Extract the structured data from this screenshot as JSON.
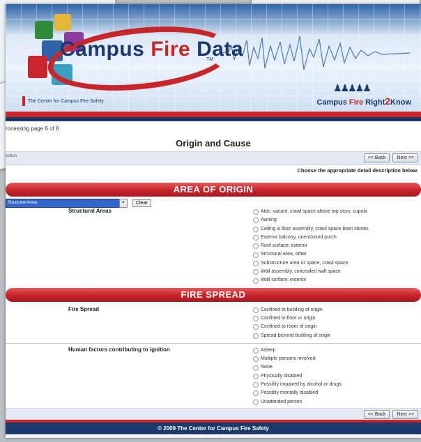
{
  "banner": {
    "logo_word1": "Campus",
    "logo_word2": "Fire",
    "logo_word3": "Data",
    "tm": "TM",
    "center_tag": "The Center for Campus Fire Safety",
    "slogan_1": "Campus",
    "slogan_2": "Fire",
    "slogan_3": "Right",
    "slogan_4": "2",
    "slogan_5": "Know"
  },
  "status": "rocessing page 6 of 8",
  "page_title": "Origin and Cause",
  "nav": {
    "left_label": "ection",
    "back_label": "<< Back",
    "next_label": "Next >>",
    "instruction": "Choose the appropriate detail description below."
  },
  "area_of_origin": {
    "header": "AREA OF ORIGIN",
    "select_value": "Structural Areas",
    "clear_label": "Clear",
    "question": "Structural Areas",
    "options": [
      "Attic: vacant, crawl space above top story, cupola",
      "Awning",
      "Ceiling & floor assembly, crawl space btwn stories",
      "Exterior balcony, unenclosed porch",
      "Roof surface: exterior",
      "Structural area, other",
      "Substructure area or space, crawl space",
      "Wall assembly, concealed wall space",
      "Wall surface: exterior"
    ]
  },
  "fire_spread": {
    "header": "FIRE SPREAD",
    "question": "Fire Spread",
    "options": [
      "Confined to building of origin",
      "Confined to floor or origin",
      "Confined to room of origin",
      "Spread beyond building of origin"
    ]
  },
  "human_factors": {
    "question": "Human factors contributing to ignition",
    "options": [
      "Asleep",
      "Multiple persons involved",
      "None",
      "Physically disabled",
      "Possibly impaired by alcohol or drugs",
      "Possibly mentally disabled",
      "Unattended person"
    ]
  },
  "bottom_nav": {
    "back_label": "<< Back",
    "next_label": "Next >>"
  },
  "footer": "© 2009 The Center for Campus Fire Safety",
  "colors": {
    "brand_red": "#c9252b",
    "brand_navy": "#1b3a6b",
    "select_blue": "#3366cc"
  }
}
